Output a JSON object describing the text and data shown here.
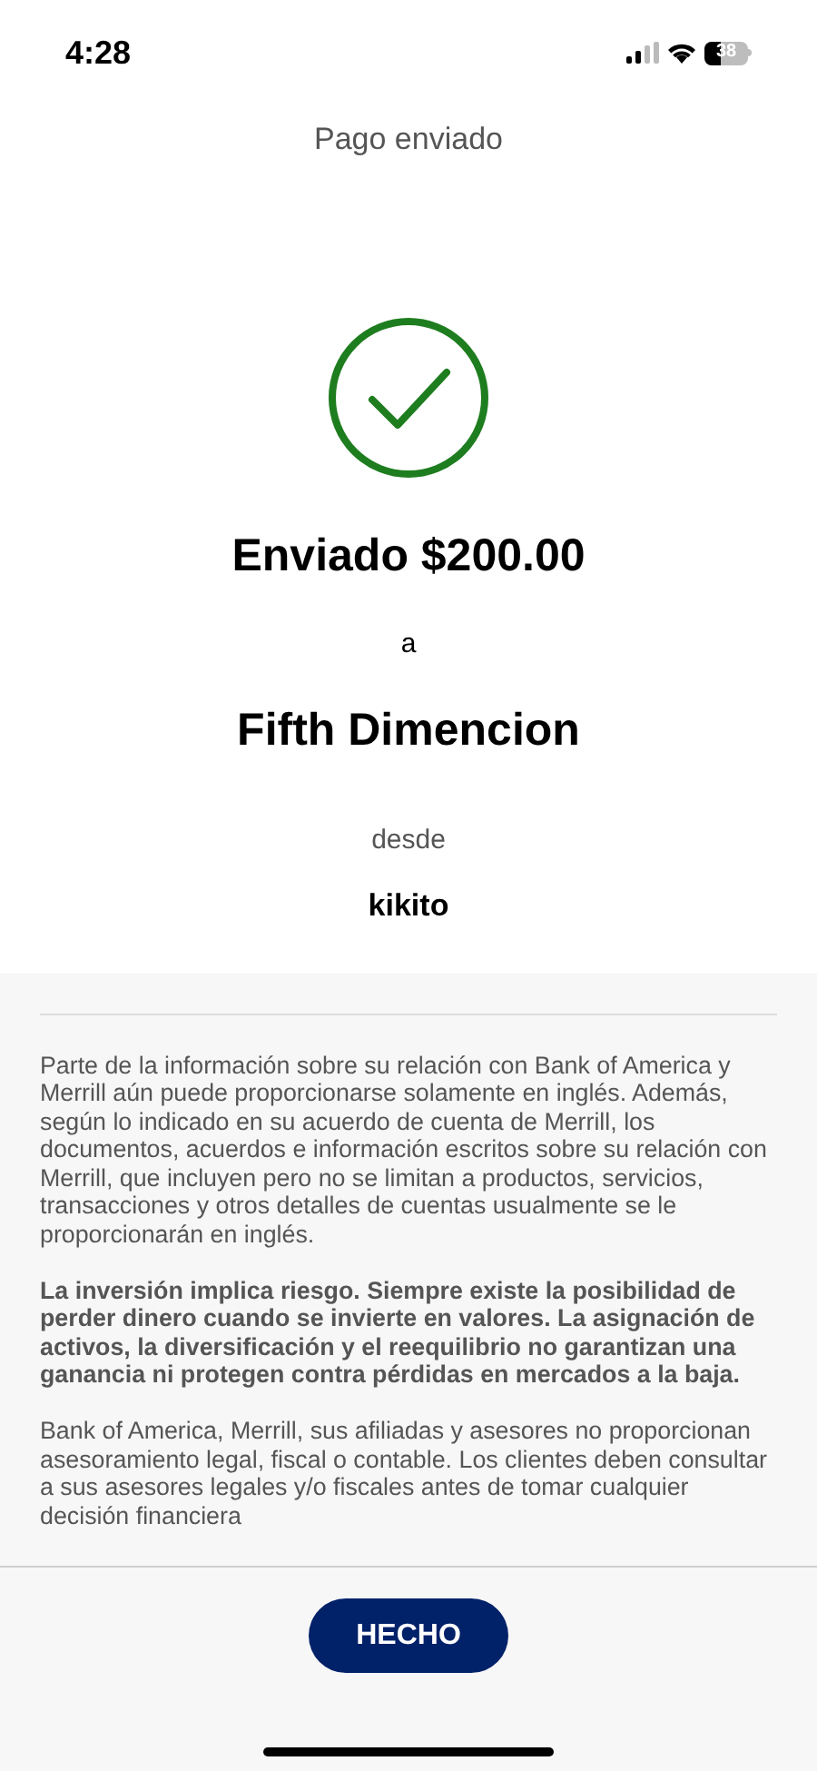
{
  "status_bar": {
    "time": "4:28",
    "battery": "38"
  },
  "header": {
    "title": "Pago enviado"
  },
  "confirmation": {
    "amount_line": "Enviado $200.00",
    "to_label": "a",
    "recipient": "Fifth Dimencion",
    "from_label": "desde",
    "sender": "kikito"
  },
  "disclosures": [
    {
      "text": "Parte de la información sobre su relación con Bank of America y Merrill aún puede proporcionarse solamente en inglés. Además, según lo indicado en su acuerdo de cuenta de Merrill, los documentos, acuerdos e información escritos sobre su relación con Merrill, que incluyen pero no se limitan a productos, servicios, transacciones y otros detalles de cuentas usualmente se le proporcionarán en inglés.",
      "bold": false
    },
    {
      "text": "La inversión implica riesgo. Siempre existe la posibilidad de perder dinero cuando se invierte en valores. La asignación de activos, la diversificación y el reequilibrio no garantizan una ganancia ni protegen contra pérdidas en mercados a la baja.",
      "bold": true
    },
    {
      "text": "Bank of America, Merrill, sus afiliadas y asesores no proporcionan asesoramiento legal, fiscal o contable. Los clientes deben consultar a sus asesores legales y/o fiscales antes de tomar cualquier decisión financiera",
      "bold": false
    }
  ],
  "footer": {
    "button": "HECHO"
  }
}
